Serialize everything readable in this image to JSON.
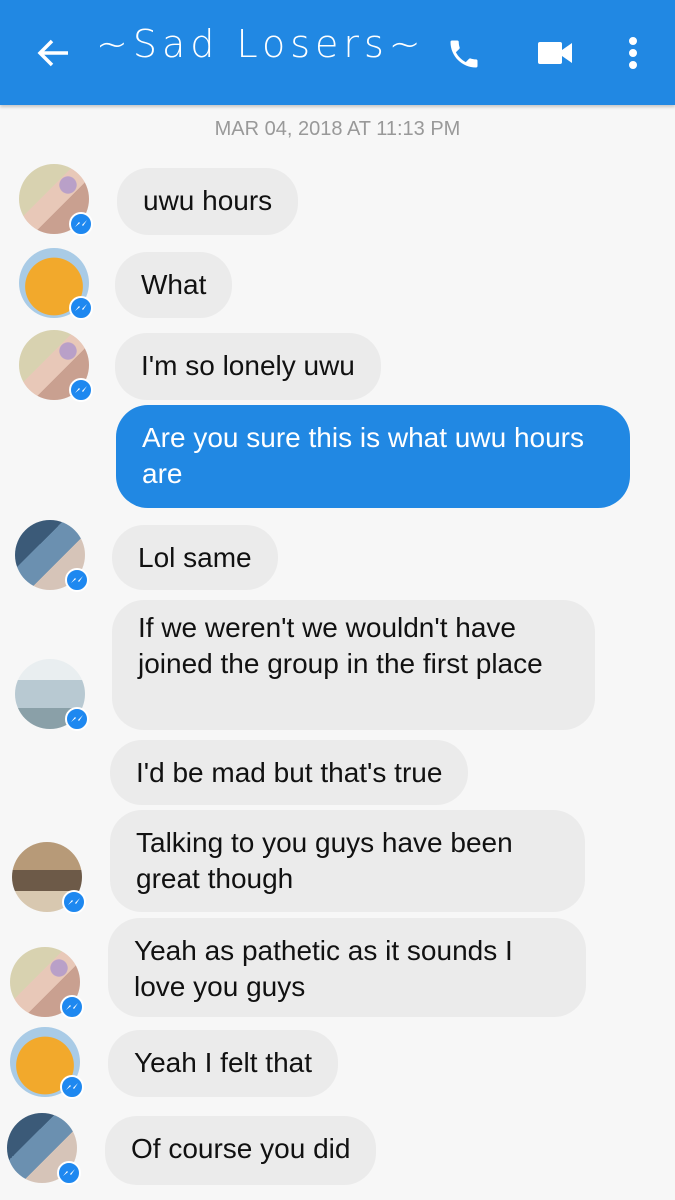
{
  "header": {
    "title": "~Sad Losers~",
    "back_icon": "arrow-left-icon",
    "call_icon": "phone-icon",
    "video_icon": "video-camera-icon",
    "menu_icon": "more-vert-icon",
    "color": "#2188e3"
  },
  "timestamp": "MAR 04, 2018 AT 11:13 PM",
  "messages": [
    {
      "text": "uwu hours",
      "sent": false
    },
    {
      "text": "What",
      "sent": false
    },
    {
      "text": "I'm so lonely uwu",
      "sent": false
    },
    {
      "text": "Are you sure this is what uwu hours are",
      "sent": true
    },
    {
      "text": "Lol same",
      "sent": false
    },
    {
      "text": "If we weren't we wouldn't have joined the group in the first place",
      "sent": false
    },
    {
      "text": "I'd be mad but that's true",
      "sent": false
    },
    {
      "text": "Talking to you guys have been great though",
      "sent": false
    },
    {
      "text": "Yeah as pathetic as it sounds I love you guys",
      "sent": false
    },
    {
      "text": "Yeah I felt that",
      "sent": false
    },
    {
      "text": "Of course you did",
      "sent": false
    }
  ]
}
